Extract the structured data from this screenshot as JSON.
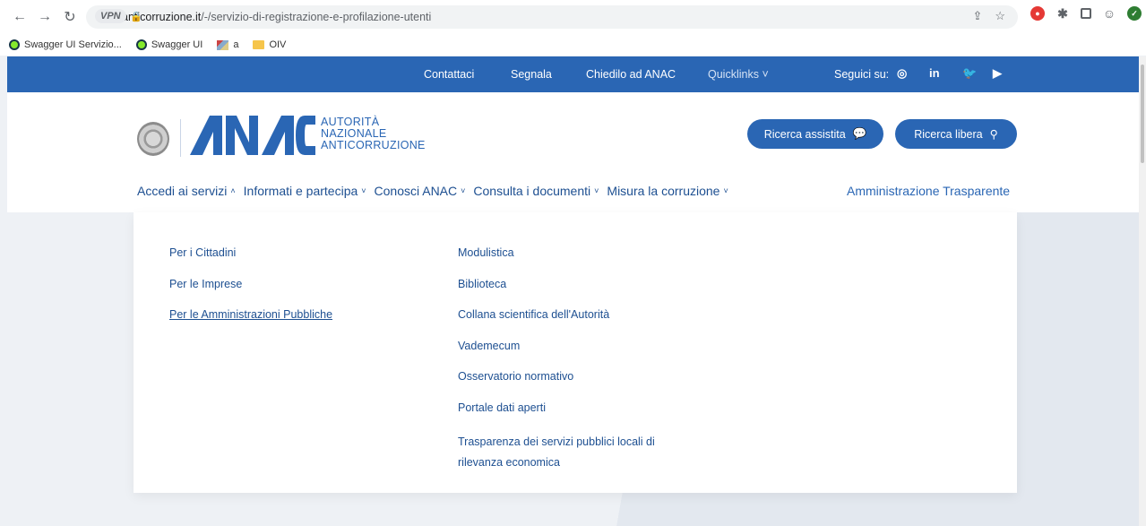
{
  "browser": {
    "url_host": "anticorruzione.it",
    "url_path": "/-/servizio-di-registrazione-e-profilazione-utenti",
    "vpn_label": "VPN",
    "bookmarks": [
      {
        "label": "Swagger UI Servizio..."
      },
      {
        "label": "Swagger UI"
      },
      {
        "label": "a"
      },
      {
        "label": "OIV"
      }
    ]
  },
  "topbar": {
    "contattaci": "Contattaci",
    "segnala": "Segnala",
    "chiedilo": "Chiedilo ad ANAC",
    "quicklinks": "Quicklinks",
    "seguici": "Seguici su:"
  },
  "logo": {
    "brand": "ANAC",
    "line1": "AUTORITÀ",
    "line2": "NAZIONALE",
    "line3": "ANTICORRUZIONE"
  },
  "buttons": {
    "ricerca_assistita": "Ricerca assistita",
    "ricerca_libera": "Ricerca libera"
  },
  "mainnav": {
    "items": [
      {
        "label": "Accedi ai servizi",
        "chevron": "˄"
      },
      {
        "label": "Informati e partecipa",
        "chevron": "˅"
      },
      {
        "label": "Conosci ANAC",
        "chevron": "˅"
      },
      {
        "label": "Consulta i documenti",
        "chevron": "˅"
      },
      {
        "label": "Misura la corruzione",
        "chevron": "˅"
      }
    ],
    "amministrazione": "Amministrazione Trasparente"
  },
  "dropdown": {
    "col_a": [
      "Per i Cittadini",
      "Per le Imprese",
      "Per le Amministrazioni Pubbliche"
    ],
    "col_b": [
      "Modulistica",
      "Biblioteca",
      "Collana scientifica dell'Autorità",
      "Vademecum",
      "Osservatorio normativo",
      "Portale dati aperti",
      "Trasparenza dei servizi pubblici locali di rilevanza economica"
    ]
  },
  "colors": {
    "primary": "#2a66b4",
    "link": "#1d4f91"
  }
}
